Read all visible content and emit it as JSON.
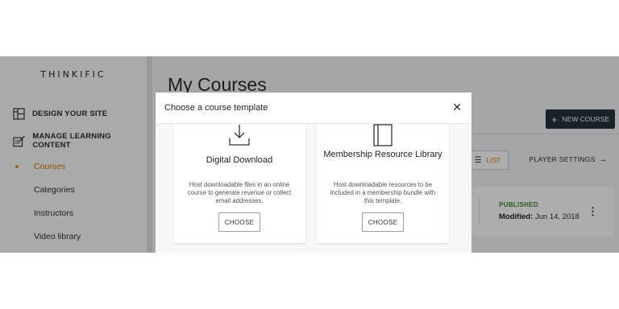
{
  "sidebar": {
    "logo": "THINKIFIC",
    "sections": [
      {
        "label": "DESIGN YOUR SITE",
        "icon": "layout-icon"
      },
      {
        "label": "MANAGE LEARNING CONTENT",
        "icon": "edit-content-icon"
      }
    ],
    "items": [
      {
        "label": "Courses",
        "active": true
      },
      {
        "label": "Categories"
      },
      {
        "label": "Instructors"
      },
      {
        "label": "Video library"
      }
    ]
  },
  "main": {
    "title": "My Courses",
    "new_course_label": "NEW COURSE",
    "list_label": "LIST",
    "player_settings_label": "PLAYER SETTINGS",
    "course": {
      "status": "PUBLISHED",
      "modified_label": "Modified:",
      "modified_date": "Jun 14, 2018"
    }
  },
  "modal": {
    "title": "Choose a course template",
    "templates": [
      {
        "title": "Digital Download",
        "description": "Host downloadable files in an online course to generate revenue or collect email addresses.",
        "button": "CHOOSE",
        "icon": "download-icon"
      },
      {
        "title": "Membership Resource Library",
        "description": "Host downloadable resources to be included in a membership bundle with this template.",
        "button": "CHOOSE",
        "icon": "book-icon"
      }
    ]
  },
  "colors": {
    "accent": "#e59f00",
    "published": "#3b8a2e",
    "primary_button": "#25313d"
  }
}
